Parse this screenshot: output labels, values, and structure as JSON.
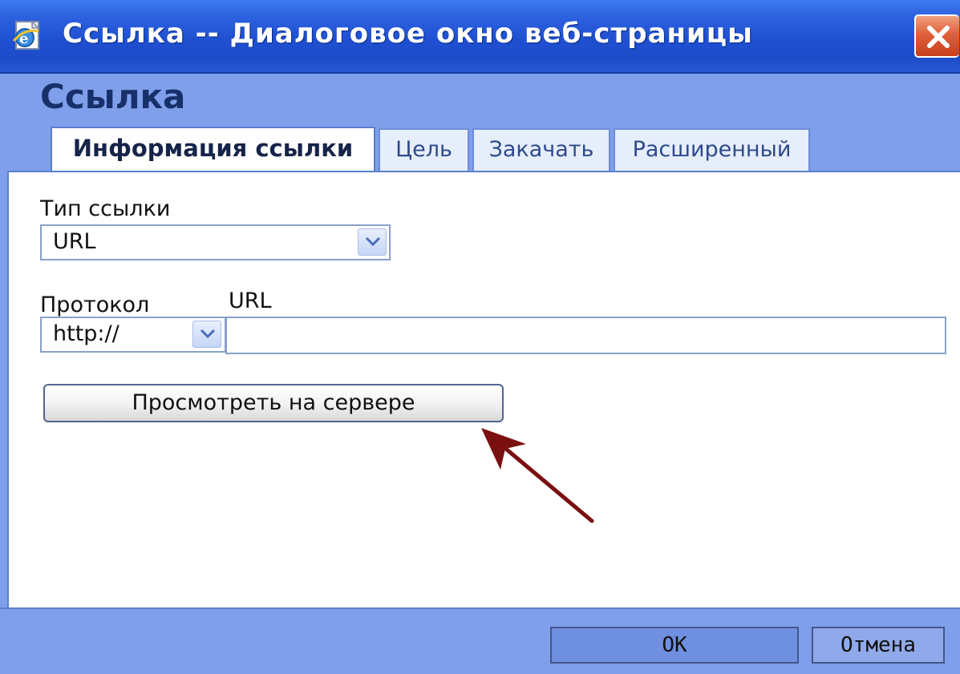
{
  "window": {
    "title": "Ссылка -- Диалоговое окно веб-страницы",
    "icon": "ie-page-icon",
    "close_icon": "close-icon"
  },
  "dialog": {
    "heading": "Ссылка"
  },
  "tabs": [
    {
      "label": "Информация ссылки",
      "active": true
    },
    {
      "label": "Цель",
      "active": false
    },
    {
      "label": "Закачать",
      "active": false
    },
    {
      "label": "Расширенный",
      "active": false
    }
  ],
  "form": {
    "link_type_label": "Тип ссылки",
    "link_type_value": "URL",
    "protocol_label": "Протокол",
    "protocol_value": "http://",
    "url_label": "URL",
    "url_value": "",
    "browse_server_label": "Просмотреть на сервере"
  },
  "footer": {
    "ok_label": "OK",
    "cancel_label": "Отмена"
  },
  "colors": {
    "titlebar": "#2456d8",
    "window_bg": "#7f9fea",
    "annotation_arrow": "#7a1010"
  }
}
